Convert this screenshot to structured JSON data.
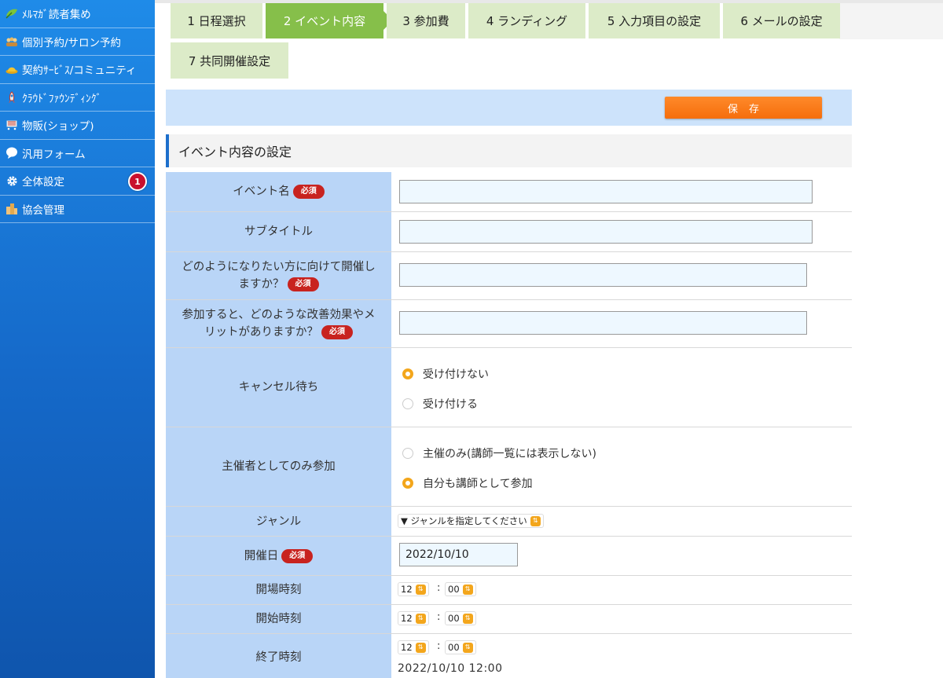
{
  "sidebar": {
    "items": [
      {
        "icon": "leaf-icon",
        "label": "ﾒﾙﾏｶﾞ読者集め"
      },
      {
        "icon": "people-icon",
        "label": "個別予約/サロン予約"
      },
      {
        "icon": "hat-icon",
        "label": "契約ｻｰﾋﾞｽ/コミュニティ"
      },
      {
        "icon": "rocket-icon",
        "label": "ｸﾗｳﾄﾞﾌｧｳﾝﾃﾞｨﾝｸﾞ"
      },
      {
        "icon": "cart-icon",
        "label": "物販(ショップ)"
      },
      {
        "icon": "speech-bubble-icon",
        "label": "汎用フォーム"
      },
      {
        "icon": "gear-icon",
        "label": "全体設定",
        "badge": "1"
      },
      {
        "icon": "buildings-icon",
        "label": "協会管理"
      }
    ]
  },
  "tabs": [
    {
      "label": "1 日程選択"
    },
    {
      "label": "2 イベント内容"
    },
    {
      "label": "3 参加費"
    },
    {
      "label": "4 ランディング"
    },
    {
      "label": "5 入力項目の設定"
    },
    {
      "label": "6 メールの設定"
    },
    {
      "label": "7 共同開催設定"
    }
  ],
  "save_label": "保存",
  "section_title": "イベント内容の設定",
  "required_label": "必須",
  "form": {
    "event_name": {
      "label": "イベント名",
      "value": ""
    },
    "subtitle": {
      "label": "サブタイトル",
      "value": ""
    },
    "target": {
      "label": "どのようになりたい方に向けて開催しますか？",
      "value": ""
    },
    "benefit": {
      "label": "参加すると、どのような改善効果やメリットがありますか？",
      "value": ""
    },
    "waitlist": {
      "label": "キャンセル待ち",
      "options": [
        "受け付けない",
        "受け付ける"
      ],
      "selected": 0
    },
    "organizer": {
      "label": "主催者としてのみ参加",
      "options": [
        "主催のみ(講師一覧には表示しない)",
        "自分も講師として参加"
      ],
      "selected": 1
    },
    "genre": {
      "label": "ジャンル",
      "value": "▼ ジャンルを指定してください"
    },
    "date": {
      "label": "開催日",
      "value": "2022/10/10"
    },
    "open_time": {
      "label": "開場時刻",
      "hour": "12",
      "minute": "00"
    },
    "start_time": {
      "label": "開始時刻",
      "hour": "12",
      "minute": "00"
    },
    "end_time": {
      "label": "終了時刻",
      "hour": "12",
      "minute": "00",
      "summary": "2022/10/10 12:00"
    },
    "time_separator": ":"
  },
  "colors": {
    "sidebar": "#1569c9",
    "tab": "#dcebc8",
    "tab_active": "#86bf4a",
    "label_bg": "#b9d5f7",
    "save": "#f56e0c",
    "required": "#c8231f",
    "radio_on": "#f3a61c"
  }
}
